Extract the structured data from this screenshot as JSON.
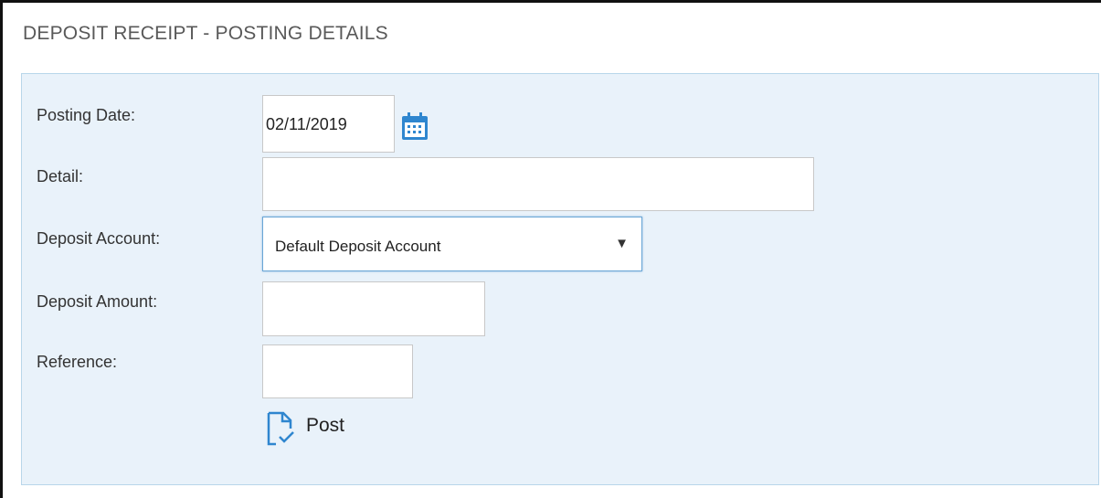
{
  "title": "DEPOSIT RECEIPT - POSTING DETAILS",
  "form": {
    "posting_date_label": "Posting Date:",
    "posting_date_value": "02/11/2019",
    "detail_label": "Detail:",
    "detail_value": "",
    "deposit_account_label": "Deposit Account:",
    "deposit_account_value": "Default Deposit Account",
    "deposit_amount_label": "Deposit Amount:",
    "deposit_amount_value": "",
    "reference_label": "Reference:",
    "reference_value": "",
    "post_label": "Post"
  },
  "icons": {
    "calendar": "calendar-icon",
    "dropdown": "dropdown-arrow-icon",
    "post": "document-check-icon"
  },
  "colors": {
    "panel_bg": "#e9f2fa",
    "panel_border": "#b8d6ea",
    "accent": "#2f86cf"
  }
}
